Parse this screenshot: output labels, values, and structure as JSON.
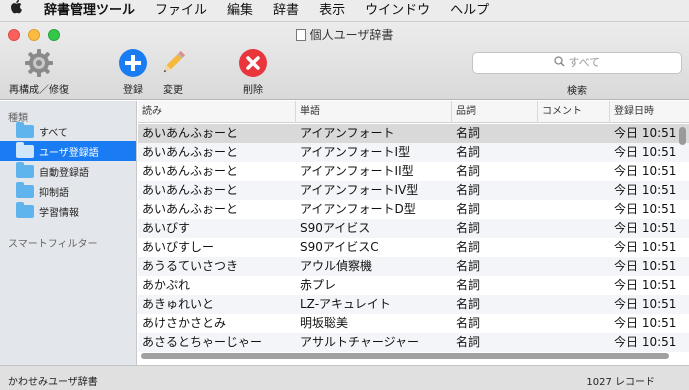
{
  "menubar": {
    "app_name": "辞書管理ツール",
    "items": [
      "ファイル",
      "編集",
      "辞書",
      "表示",
      "ウインドウ",
      "ヘルプ"
    ]
  },
  "window": {
    "title": "個人ユーザ辞書"
  },
  "toolbar": {
    "rebuild_label": "再構成／修復",
    "register_label": "登録",
    "edit_label": "変更",
    "delete_label": "削除",
    "search_placeholder": "すべて",
    "search_label": "検索"
  },
  "sidebar": {
    "header": "種類",
    "items": [
      {
        "label": "すべて",
        "selected": false
      },
      {
        "label": "ユーザ登録語",
        "selected": true
      },
      {
        "label": "自動登録語",
        "selected": false
      },
      {
        "label": "抑制語",
        "selected": false
      },
      {
        "label": "学習情報",
        "selected": false
      }
    ],
    "smart_filter": "スマートフィルター"
  },
  "table": {
    "columns": [
      "読み",
      "単語",
      "品詞",
      "コメント",
      "登録日時"
    ],
    "rows": [
      [
        "あいあんふぉーと",
        "アイアンフォート",
        "名詞",
        "",
        "今日 10:51"
      ],
      [
        "あいあんふぉーと",
        "アイアンフォートI型",
        "名詞",
        "",
        "今日 10:51"
      ],
      [
        "あいあんふぉーと",
        "アイアンフォートII型",
        "名詞",
        "",
        "今日 10:51"
      ],
      [
        "あいあんふぉーと",
        "アイアンフォートIV型",
        "名詞",
        "",
        "今日 10:51"
      ],
      [
        "あいあんふぉーと",
        "アイアンフォートD型",
        "名詞",
        "",
        "今日 10:51"
      ],
      [
        "あいびす",
        "S90アイビス",
        "名詞",
        "",
        "今日 10:51"
      ],
      [
        "あいびすしー",
        "S90アイビスC",
        "名詞",
        "",
        "今日 10:51"
      ],
      [
        "あうるていさつき",
        "アウル偵察機",
        "名詞",
        "",
        "今日 10:51"
      ],
      [
        "あかぷれ",
        "赤プレ",
        "名詞",
        "",
        "今日 10:51"
      ],
      [
        "あきゅれいと",
        "LZ-アキュレイト",
        "名詞",
        "",
        "今日 10:51"
      ],
      [
        "あけさかさとみ",
        "明坂聡美",
        "名詞",
        "",
        "今日 10:51"
      ],
      [
        "あさるとちゃーじゃー",
        "アサルトチャージャー",
        "名詞",
        "",
        "今日 10:51"
      ]
    ]
  },
  "statusbar": {
    "dictionary_name": "かわせみユーザ辞書",
    "record_count": "1027 レコード"
  },
  "colors": {
    "selection_blue": "#1a7cf2",
    "add_button": "#1a7cf2",
    "delete_button": "#e8363c"
  }
}
